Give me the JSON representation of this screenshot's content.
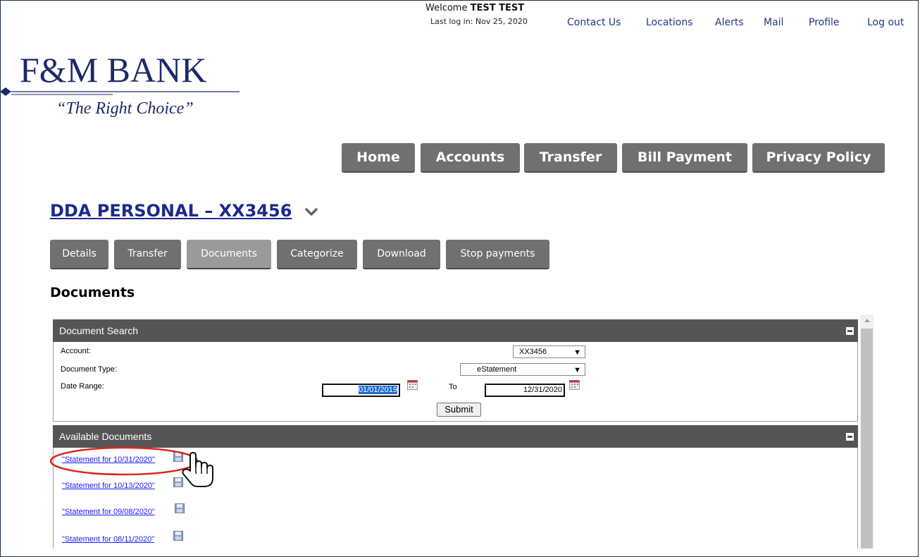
{
  "header": {
    "welcome_prefix": "Welcome",
    "user_name": "TEST TEST",
    "last_login": "Last log in: Nov 25, 2020",
    "links": [
      "Contact Us",
      "Locations",
      "Alerts",
      "Mail",
      "Profile",
      "Log out"
    ]
  },
  "logo": {
    "name": "F&M BANK",
    "tagline": "“The Right Choice”"
  },
  "main_nav": [
    "Home",
    "Accounts",
    "Transfer",
    "Bill Payment",
    "Privacy Policy"
  ],
  "account": {
    "title": "DDA PERSONAL – XX3456",
    "dropdown_icon": "chevron-down-icon"
  },
  "sub_tabs": [
    "Details",
    "Transfer",
    "Documents",
    "Categorize",
    "Download",
    "Stop payments"
  ],
  "active_sub_tab": "Documents",
  "page_heading": "Documents",
  "document_search": {
    "title": "Document Search",
    "account_label": "Account:",
    "account_value": "XX3456",
    "doc_type_label": "Document Type:",
    "doc_type_value": "eStatement",
    "date_range_label": "Date Range:",
    "date_from": "01/01/2019",
    "to_label": "To",
    "date_to": "12/31/2020",
    "submit_label": "Submit"
  },
  "available_documents": {
    "title": "Available Documents",
    "items": [
      "\"Statement for 10/31/2020\"",
      "\"Statement for 10/13/2020\"",
      "\"Statement for 09/08/2020\"",
      "\"Statement for 08/11/2020\""
    ]
  },
  "colors": {
    "nav_button": "#707070",
    "panel_header": "#555555",
    "account_title": "#1c2a8a",
    "link": "#1a1aff",
    "highlight": "#d9261c"
  }
}
